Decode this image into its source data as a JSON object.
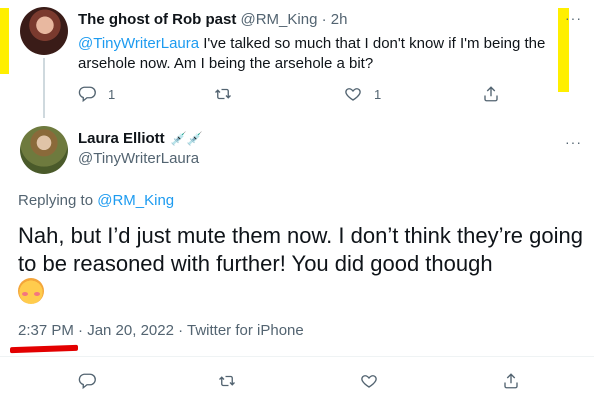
{
  "parent_tweet": {
    "display_name": "The ghost of Rob past",
    "handle": "@RM_King",
    "separator": "·",
    "time": "2h",
    "mention": "@TinyWriterLaura",
    "text": " I've talked so much that I don't know if I'm being the arsehole now. Am I being the arsehole a bit?",
    "reply_count": "1",
    "like_count": "1"
  },
  "main_tweet": {
    "display_name": "Laura Elliott",
    "name_emoji": "💉💉",
    "handle": "@TinyWriterLaura",
    "replying_prefix": "Replying to ",
    "replying_to": "@RM_King",
    "text": "Nah, but I’d just mute them now. I don’t think they’re going to be reasoned with further! You did good though",
    "time": "2:37 PM",
    "meta_rest": " · Jan 20, 2022 · Twitter for iPhone"
  },
  "icons": {
    "reply": "reply-icon",
    "retweet": "retweet-icon",
    "like": "heart-icon",
    "share": "share-icon",
    "more": "more-icon",
    "emoji": "blush-emoji"
  },
  "colors": {
    "link": "#1d9bf0",
    "muted": "#536471",
    "highlight_yellow": "#ffef00",
    "underline_red": "#e30000"
  }
}
